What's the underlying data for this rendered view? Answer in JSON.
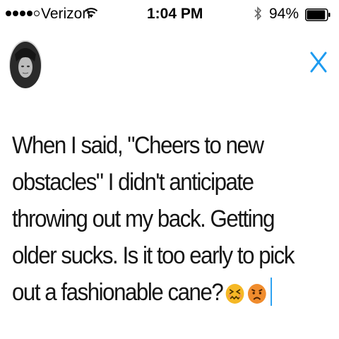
{
  "status_bar": {
    "carrier": "Verizon",
    "time": "1:04 PM",
    "battery_percent": "94%",
    "signal_bars_filled": 4,
    "signal_bars_total": 5,
    "battery_level": 0.94
  },
  "header": {
    "avatar_icon": "user-avatar",
    "close_icon": "close-x-icon",
    "accent_color": "#1d9bf0"
  },
  "compose": {
    "lines": [
      "When I said, \"Cheers to new",
      "obstacles\" I didn't anticipate",
      "throwing out my back. Getting",
      "older sucks. Is it too early to pick",
      "out a fashionable cane?"
    ],
    "emojis": [
      "confounded-face-emoji",
      "pouting-face-emoji"
    ]
  }
}
